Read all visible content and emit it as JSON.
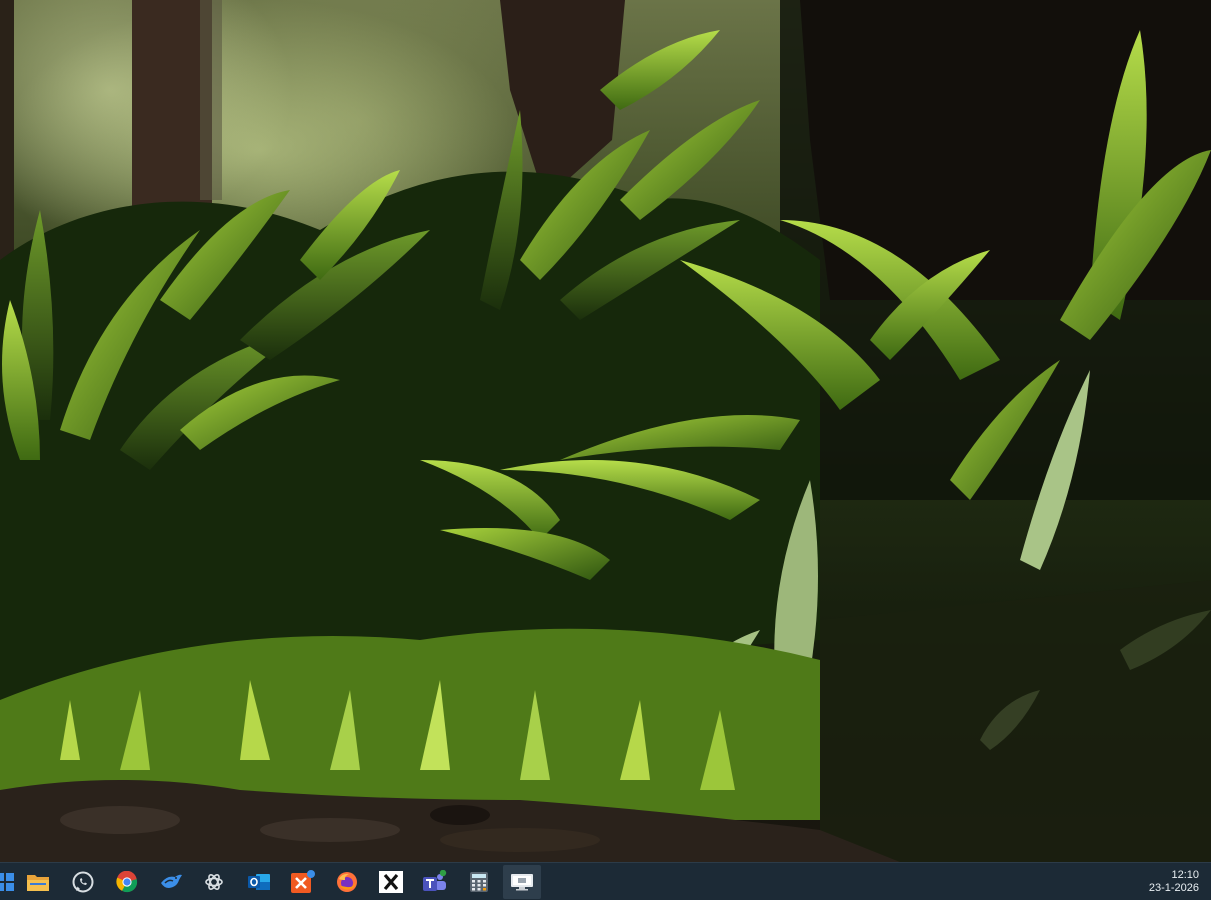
{
  "wallpaper": {
    "name": "forest-plants-wallpaper",
    "colors": {
      "sky_haze": "#c9cf93",
      "foliage_light": "#8fbf2e",
      "foliage_dark": "#1e3410",
      "soil": "#2a221b",
      "trunk": "#2b1f18"
    }
  },
  "taskbar": {
    "background": "#1c2a36",
    "apps": [
      {
        "name": "start-menu-icon"
      },
      {
        "name": "file-manager-icon"
      },
      {
        "name": "whatsapp-icon"
      },
      {
        "name": "chrome-icon"
      },
      {
        "name": "app-bird-icon"
      },
      {
        "name": "chatgpt-icon"
      },
      {
        "name": "outlook-icon"
      },
      {
        "name": "xmind-icon"
      },
      {
        "name": "firefox-icon"
      },
      {
        "name": "x-app-icon"
      },
      {
        "name": "teams-icon"
      },
      {
        "name": "calculator-icon"
      },
      {
        "name": "remote-desktop-icon",
        "active": true
      }
    ],
    "clock": {
      "time": "12:10",
      "date": "23-1-2026"
    }
  }
}
